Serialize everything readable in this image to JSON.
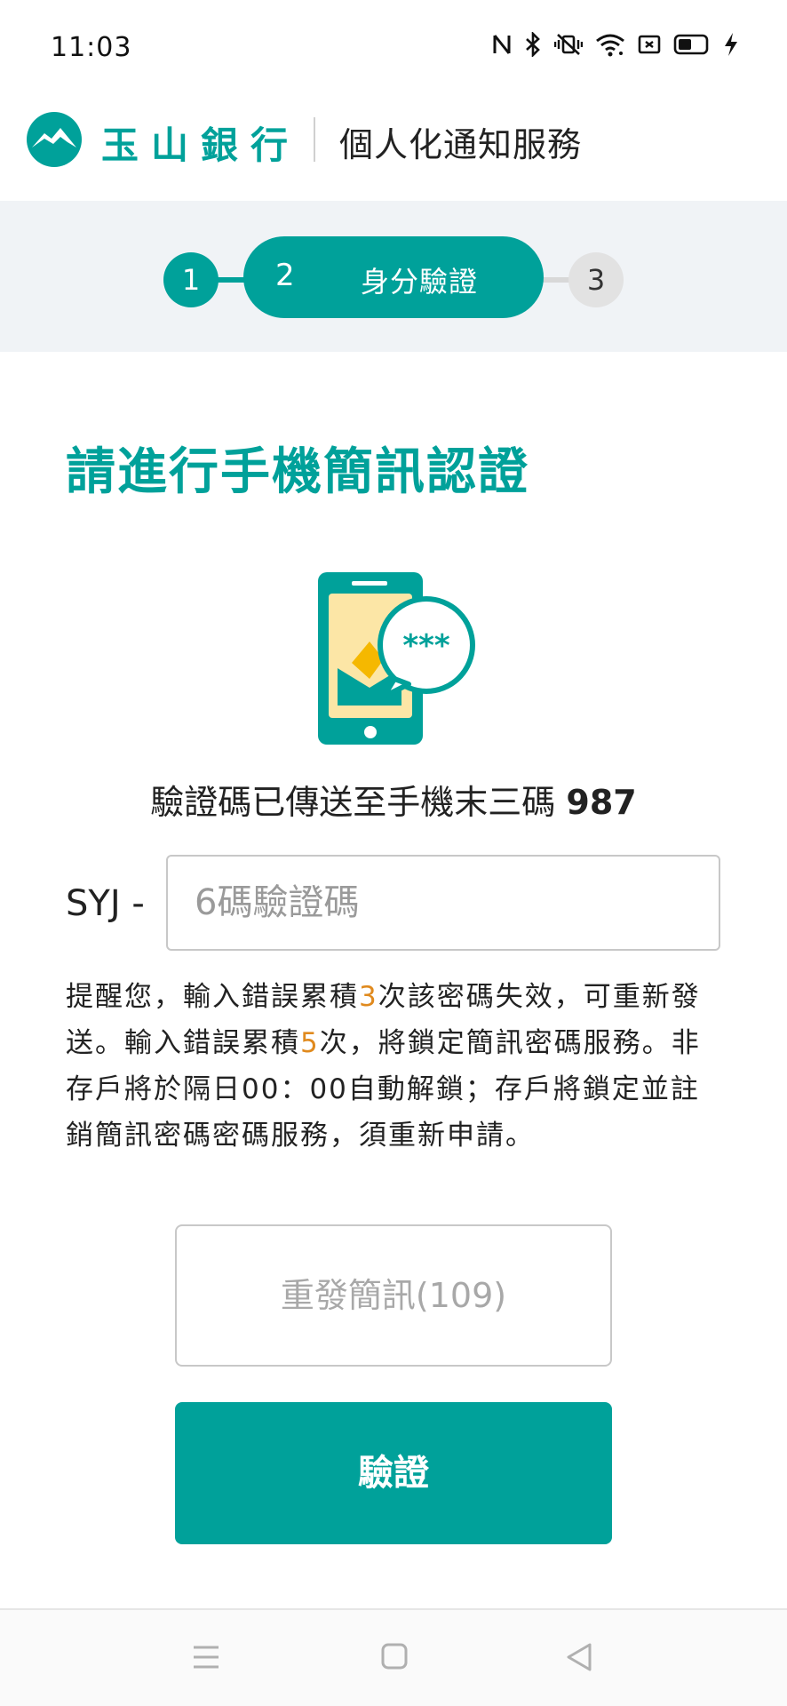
{
  "status_bar": {
    "time": "11:03",
    "icons": [
      "nfc-icon",
      "bluetooth-icon",
      "vibrate-icon",
      "wifi-icon",
      "sim-icon",
      "battery-icon",
      "charging-icon"
    ]
  },
  "header": {
    "bank_name": "玉山銀行",
    "service_title": "個人化通知服務"
  },
  "stepper": {
    "step1": "1",
    "step2_num": "2",
    "step2_label": "身分驗證",
    "step3": "3"
  },
  "main": {
    "title": "請進行手機簡訊認證",
    "sent_prefix": "驗證碼已傳送至手機末三碼 ",
    "phone_last3": "987",
    "code_prefix": "SYJ -",
    "code_placeholder": "6碼驗證碼",
    "code_value": "",
    "notice_part1": "提醒您，輸入錯誤累積",
    "notice_count1": "3",
    "notice_part2": "次該密碼失效，可重新發送。輸入錯誤累積",
    "notice_count2": "5",
    "notice_part3": "次，將鎖定簡訊密碼服務。非存戶將於隔日00：00自動解鎖；存戶將鎖定並註銷簡訊密碼密碼服務，須重新申請。",
    "resend_label": "重發簡訊(109)",
    "verify_label": "驗證"
  },
  "colors": {
    "brand": "#00a19a",
    "highlight": "#e08a1e",
    "disabled_text": "#a8a8a8"
  },
  "nav_bar": {
    "icons": [
      "menu-icon",
      "home-icon",
      "back-icon"
    ]
  }
}
